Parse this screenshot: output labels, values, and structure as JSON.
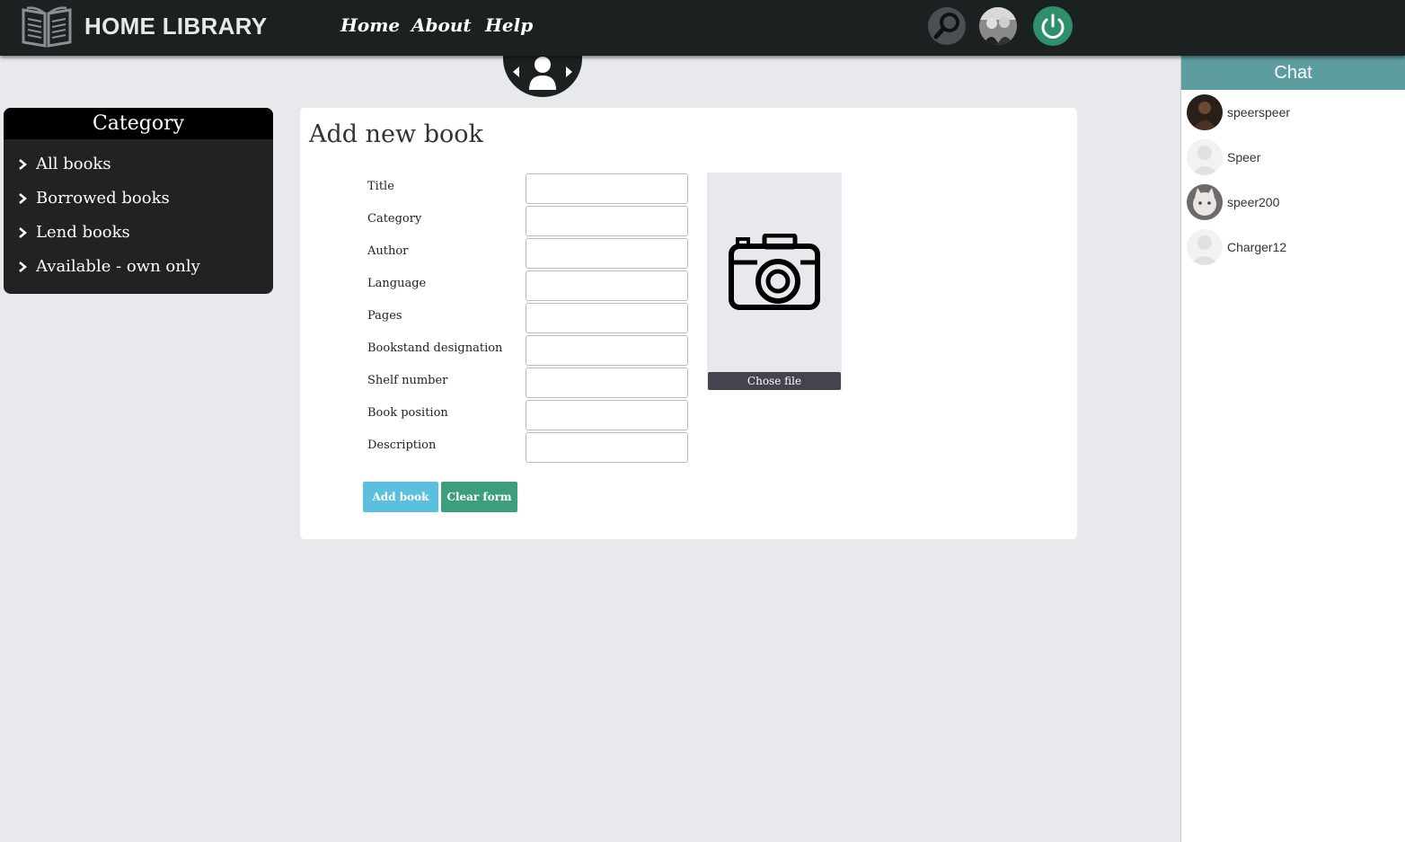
{
  "header": {
    "brand": "HOME LIBRARY",
    "nav": [
      {
        "label": "Home"
      },
      {
        "label": "About"
      },
      {
        "label": "Help"
      }
    ]
  },
  "category": {
    "title": "Category",
    "items": [
      {
        "label": "All books"
      },
      {
        "label": "Borrowed books"
      },
      {
        "label": "Lend books"
      },
      {
        "label": "Available - own only"
      }
    ]
  },
  "form": {
    "title": "Add new book",
    "fields": [
      {
        "label": "Title",
        "value": ""
      },
      {
        "label": "Category",
        "value": ""
      },
      {
        "label": "Author",
        "value": ""
      },
      {
        "label": "Language",
        "value": ""
      },
      {
        "label": "Pages",
        "value": ""
      },
      {
        "label": "Bookstand designation",
        "value": ""
      },
      {
        "label": "Shelf number",
        "value": ""
      },
      {
        "label": "Book position",
        "value": ""
      },
      {
        "label": "Description",
        "value": ""
      }
    ],
    "file_button": "Chose file",
    "add_button": "Add book",
    "clear_button": "Clear form"
  },
  "chat": {
    "title": "Chat",
    "users": [
      {
        "name": "speerspeer"
      },
      {
        "name": "Speer"
      },
      {
        "name": "speer200"
      },
      {
        "name": "Charger12"
      }
    ]
  },
  "colors": {
    "topbar": "#1b2021",
    "chat_header": "#5e9d9f",
    "add_button": "#5bc0de",
    "clear_button": "#3d9e7e",
    "power_button": "#2f8f6a"
  }
}
